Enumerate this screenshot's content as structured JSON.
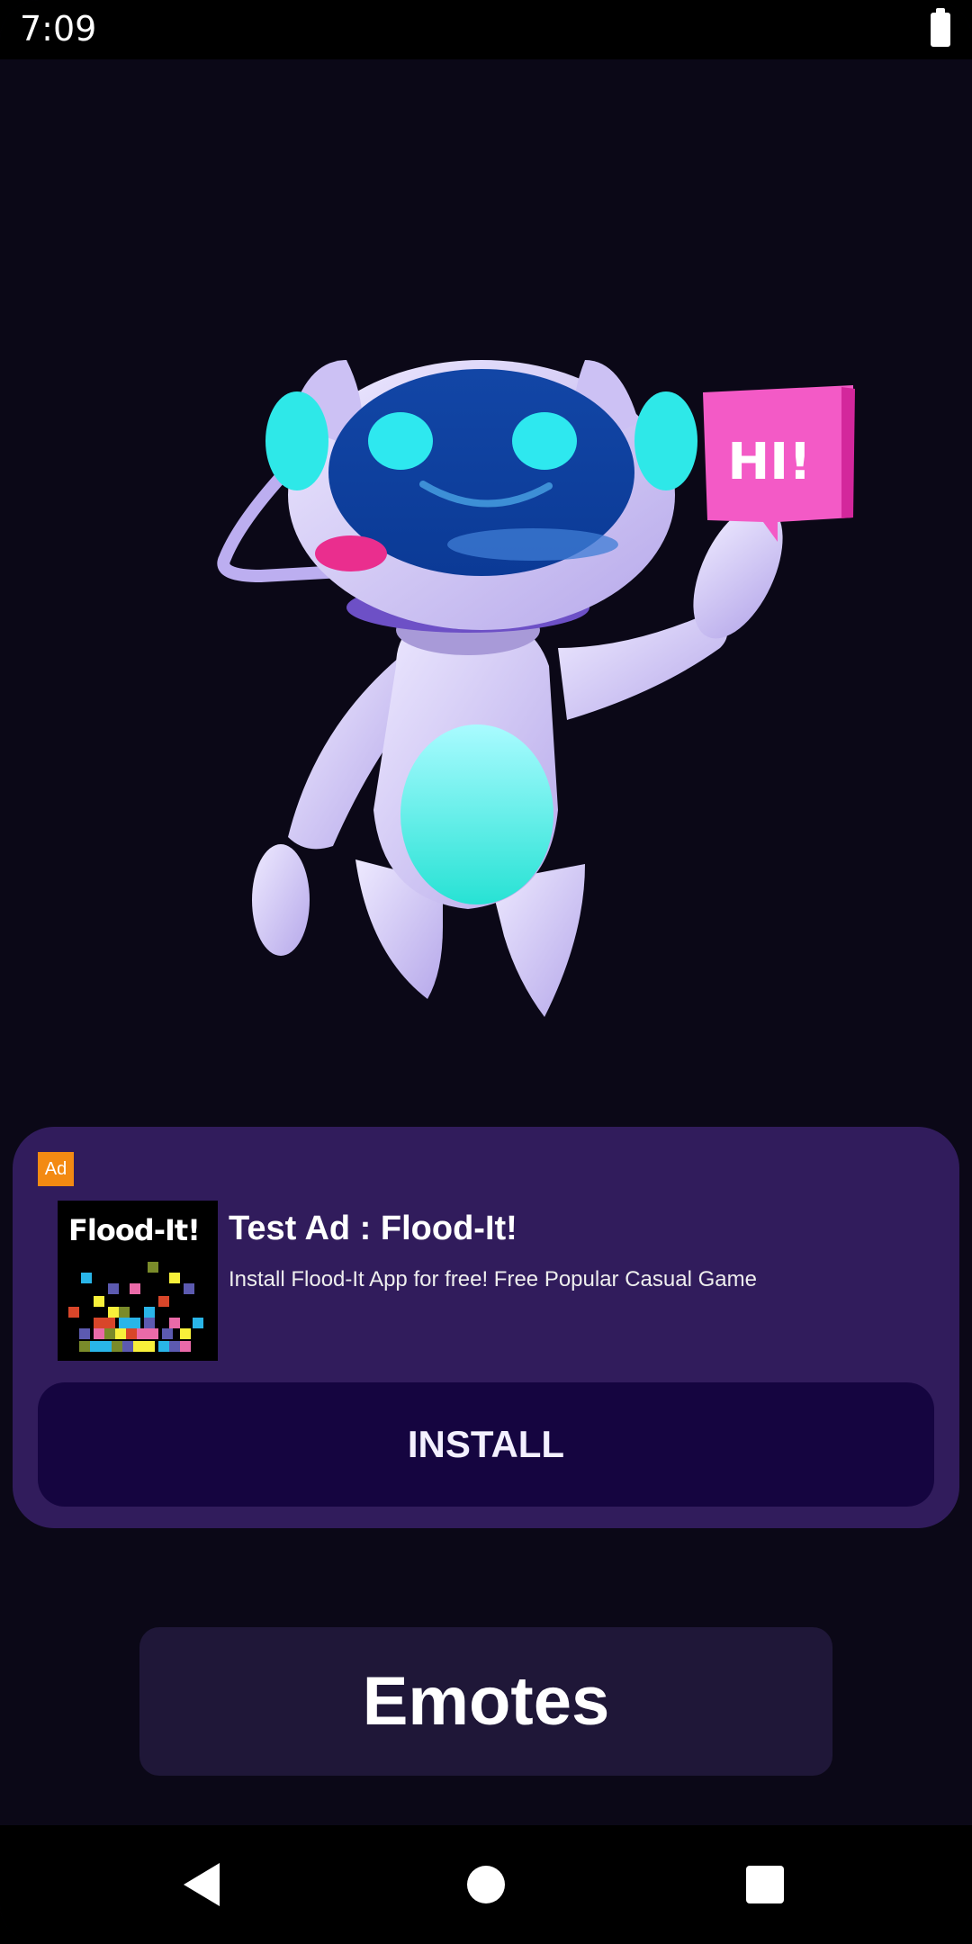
{
  "status_bar": {
    "time": "7:09"
  },
  "illustration": {
    "sign_text": "HI!"
  },
  "ad": {
    "badge": "Ad",
    "icon_title": "Flood-It!",
    "headline": "Test Ad : Flood-It!",
    "body": "Install Flood-It App for free! Free Popular Casual Game",
    "cta": "INSTALL"
  },
  "main": {
    "emotes_label": "Emotes"
  },
  "colors": {
    "background": "#0b0817",
    "ad_card": "#311c5c",
    "install_button": "#150540",
    "emotes_button": "#1f1738",
    "ad_badge": "#f38a12"
  }
}
